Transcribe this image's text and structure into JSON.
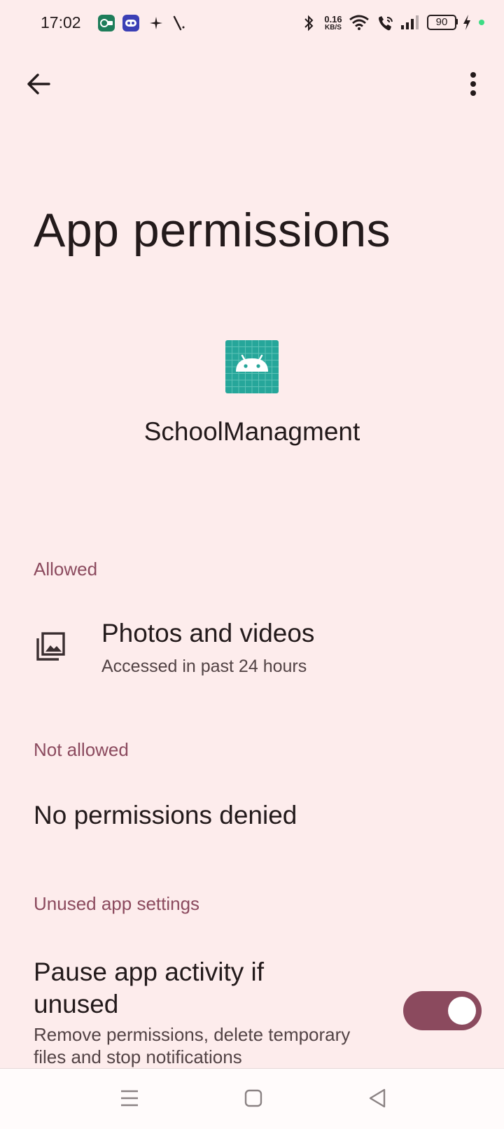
{
  "status_bar": {
    "time": "17:02",
    "notification_icons": [
      "sbi-app-icon",
      "chat-bot-icon",
      "sparkle-icon",
      "slash-icon"
    ],
    "network_speed_value": "0.16",
    "network_speed_unit": "KB/S",
    "battery_level": "90",
    "charging": true,
    "dot_color": "#3ddc84"
  },
  "app_bar": {
    "back_icon": "arrow-back-icon",
    "more_icon": "more-vert-icon"
  },
  "page": {
    "title": "App permissions",
    "app_name": "SchoolManagment",
    "app_icon_color": "#26a69a"
  },
  "sections": {
    "allowed": {
      "header": "Allowed",
      "items": [
        {
          "title": "Photos and videos",
          "subtitle": "Accessed in past 24 hours",
          "icon": "photo-library-icon"
        }
      ]
    },
    "not_allowed": {
      "header": "Not allowed",
      "empty_text": "No permissions denied"
    },
    "unused": {
      "header": "Unused app settings",
      "pause_title": "Pause app activity if unused",
      "pause_subtitle": "Remove permissions, delete temporary files and stop notifications",
      "toggle_on": true
    }
  },
  "nav_bar": {
    "items": [
      "menu-icon",
      "home-square-icon",
      "back-triangle-icon"
    ]
  },
  "colors": {
    "background": "#fdecec",
    "accent": "#8b4a5e",
    "text_primary": "#231a1b",
    "text_secondary": "#524345"
  }
}
